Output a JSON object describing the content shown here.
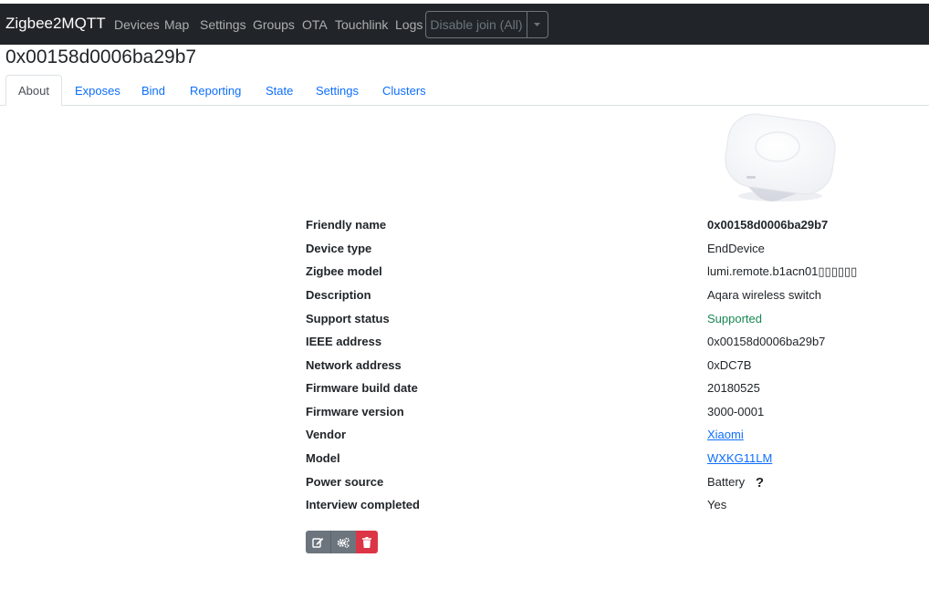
{
  "navbar": {
    "brand": "Zigbee2MQTT",
    "links": [
      "Devices",
      "Map",
      "Settings",
      "Groups",
      "OTA",
      "Touchlink",
      "Logs"
    ],
    "join_button": "Disable join (All)"
  },
  "page_title": "0x00158d0006ba29b7",
  "tabs": [
    "About",
    "Exposes",
    "Bind",
    "Reporting",
    "State",
    "Settings",
    "Clusters"
  ],
  "active_tab": "About",
  "info": [
    {
      "label": "Friendly name",
      "value": "0x00158d0006ba29b7"
    },
    {
      "label": "Device type",
      "value": "EndDevice"
    },
    {
      "label": "Zigbee model",
      "value": "lumi.remote.b1acn01▯▯▯▯▯▯"
    },
    {
      "label": "Description",
      "value": "Aqara wireless switch"
    },
    {
      "label": "Support status",
      "value": "Supported"
    },
    {
      "label": "IEEE address",
      "value": "0x00158d0006ba29b7"
    },
    {
      "label": "Network address",
      "value": "0xDC7B"
    },
    {
      "label": "Firmware build date",
      "value": "20180525"
    },
    {
      "label": "Firmware version",
      "value": "3000-0001"
    },
    {
      "label": "Vendor",
      "value": "Xiaomi"
    },
    {
      "label": "Model",
      "value": "WXKG11LM"
    },
    {
      "label": "Power source",
      "value": "Battery"
    },
    {
      "label": "Interview completed",
      "value": "Yes"
    }
  ],
  "icons": {
    "edit": "edit-icon",
    "reconfigure": "gears-icon",
    "delete": "trash-icon",
    "power_help": "question-icon"
  },
  "colors": {
    "navbar_bg": "#212529",
    "link": "#0d6efd",
    "supported": "#198754",
    "secondary_btn": "#6c757d",
    "danger_btn": "#dc3545"
  }
}
